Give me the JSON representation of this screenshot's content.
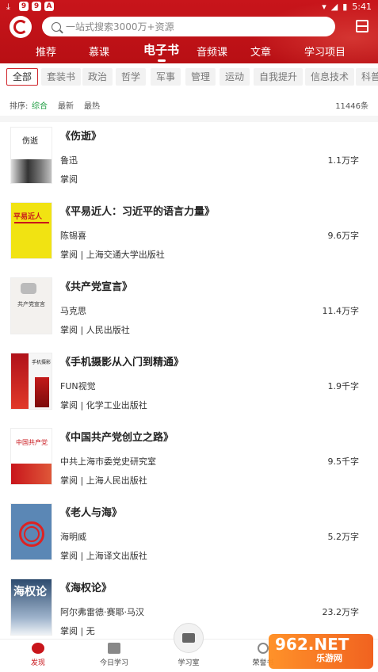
{
  "status_bar": {
    "time": "5:41",
    "left_badges": [
      "9",
      "9",
      "A"
    ]
  },
  "search": {
    "placeholder": "一站式搜索3000万+资源"
  },
  "nav_tabs": [
    {
      "label": "推荐"
    },
    {
      "label": "慕课"
    },
    {
      "label": "电子书",
      "active": true
    },
    {
      "label": "音频课"
    },
    {
      "label": "文章"
    },
    {
      "label": "学习项目"
    }
  ],
  "categories": [
    {
      "label": "全部",
      "active": true
    },
    {
      "label": "套装书"
    },
    {
      "label": "政治"
    },
    {
      "label": "哲学"
    },
    {
      "label": "军事"
    },
    {
      "label": "管理"
    },
    {
      "label": "运动"
    },
    {
      "label": "自我提升"
    },
    {
      "label": "信息技术"
    },
    {
      "label": "科普"
    }
  ],
  "sort": {
    "label": "排序:",
    "options": [
      {
        "label": "综合",
        "active": true
      },
      {
        "label": "最新"
      },
      {
        "label": "最热"
      }
    ],
    "count": "11446条"
  },
  "books": [
    {
      "title": "《伤逝》",
      "author": "鲁迅",
      "publisher": "掌阅",
      "words": "1.1万字",
      "cover_text": "伤逝"
    },
    {
      "title": "《平易近人：习近平的语言力量》",
      "author": "陈锡喜",
      "publisher": "掌阅 | 上海交通大学出版社",
      "words": "9.6万字",
      "cover_text": "平易近人"
    },
    {
      "title": "《共产党宣言》",
      "author": "马克思",
      "publisher": "掌阅 | 人民出版社",
      "words": "11.4万字",
      "cover_text": "共产党宣言"
    },
    {
      "title": "《手机摄影从入门到精通》",
      "author": "FUN视觉",
      "publisher": "掌阅 | 化学工业出版社",
      "words": "1.9千字",
      "cover_text": "手机摄影"
    },
    {
      "title": "《中国共产党创立之路》",
      "author": "中共上海市委党史研究室",
      "publisher": "掌阅 | 上海人民出版社",
      "words": "9.5千字",
      "cover_text": "中国共产党"
    },
    {
      "title": "《老人与海》",
      "author": "海明威",
      "publisher": "掌阅 | 上海译文出版社",
      "words": "5.2万字",
      "cover_text": ""
    },
    {
      "title": "《海权论》",
      "author": "阿尔弗雷德·赛耶·马汉",
      "publisher": "掌阅 | 无",
      "words": "23.2万字",
      "cover_text": "海权论"
    }
  ],
  "bottom_nav": [
    {
      "label": "发现",
      "icon": "discover-icon",
      "active": true
    },
    {
      "label": "今日学习",
      "icon": "book-icon"
    },
    {
      "label": "学习室",
      "icon": "play-icon"
    },
    {
      "label": "荣誉书",
      "icon": "people-icon"
    }
  ],
  "watermark": {
    "text": "962.NET",
    "sub": "乐游网"
  }
}
